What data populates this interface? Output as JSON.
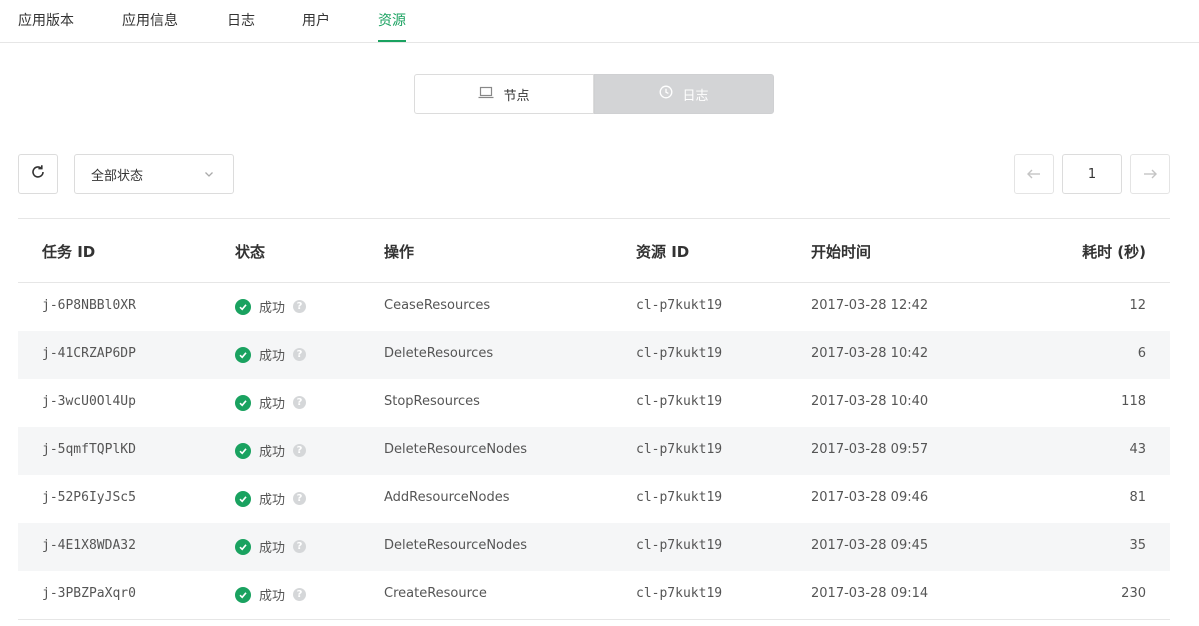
{
  "tabs": [
    {
      "label": "应用版本"
    },
    {
      "label": "应用信息"
    },
    {
      "label": "日志"
    },
    {
      "label": "用户"
    },
    {
      "label": "资源",
      "active": true
    }
  ],
  "segment": {
    "nodes_label": "节点",
    "nodes_icon": "laptop-icon",
    "logs_label": "日志",
    "logs_icon": "clock-icon",
    "selected": "日志"
  },
  "toolbar": {
    "refresh_icon": "refresh-icon",
    "status_filter": "全部状态",
    "page": "1"
  },
  "table": {
    "headers": {
      "task_id": "任务 ID",
      "status": "状态",
      "action": "操作",
      "resource_id": "资源 ID",
      "start_time": "开始时间",
      "duration": "耗时 (秒)"
    },
    "rows": [
      {
        "task_id": "j-6P8NBBl0XR",
        "status": "成功",
        "action": "CeaseResources",
        "resource_id": "cl-p7kukt19",
        "start_time": "2017-03-28 12:42",
        "duration": "12"
      },
      {
        "task_id": "j-41CRZAP6DP",
        "status": "成功",
        "action": "DeleteResources",
        "resource_id": "cl-p7kukt19",
        "start_time": "2017-03-28 10:42",
        "duration": "6"
      },
      {
        "task_id": "j-3wcU0Ol4Up",
        "status": "成功",
        "action": "StopResources",
        "resource_id": "cl-p7kukt19",
        "start_time": "2017-03-28 10:40",
        "duration": "118"
      },
      {
        "task_id": "j-5qmfTQPlKD",
        "status": "成功",
        "action": "DeleteResourceNodes",
        "resource_id": "cl-p7kukt19",
        "start_time": "2017-03-28 09:57",
        "duration": "43"
      },
      {
        "task_id": "j-52P6IyJSc5",
        "status": "成功",
        "action": "AddResourceNodes",
        "resource_id": "cl-p7kukt19",
        "start_time": "2017-03-28 09:46",
        "duration": "81"
      },
      {
        "task_id": "j-4E1X8WDA32",
        "status": "成功",
        "action": "DeleteResourceNodes",
        "resource_id": "cl-p7kukt19",
        "start_time": "2017-03-28 09:45",
        "duration": "35"
      },
      {
        "task_id": "j-3PBZPaXqr0",
        "status": "成功",
        "action": "CreateResource",
        "resource_id": "cl-p7kukt19",
        "start_time": "2017-03-28 09:14",
        "duration": "230"
      }
    ]
  },
  "colors": {
    "accent": "#1aa260",
    "row_alt": "#f5f6f7",
    "segment_selected": "#d3d4d6"
  }
}
